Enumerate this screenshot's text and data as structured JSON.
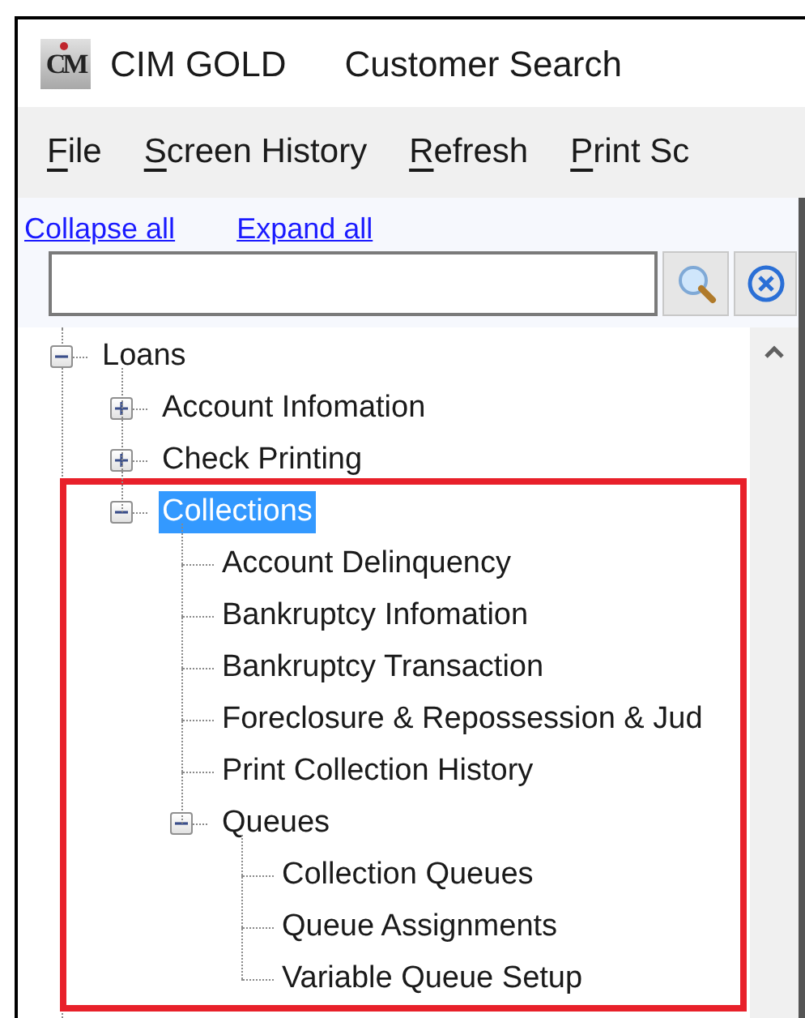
{
  "window": {
    "logo": "CM",
    "app_name": "CIM GOLD",
    "title": "Customer Search"
  },
  "menu": [
    {
      "label": "File"
    },
    {
      "label": "Screen History"
    },
    {
      "label": "Refresh"
    },
    {
      "label": "Print Sc"
    }
  ],
  "links": [
    "Collapse all",
    "Expand all"
  ],
  "tree": [
    {
      "label": "Loans",
      "kind": "group",
      "expanded": true,
      "selected": false,
      "children": [
        {
          "label": "Account Infomation",
          "kind": "group",
          "expanded": false,
          "selected": false
        },
        {
          "label": "Check Printing",
          "kind": "group",
          "expanded": false,
          "selected": false
        },
        {
          "label": "Collections",
          "kind": "group",
          "expanded": true,
          "selected": true,
          "highlighted": true,
          "children": [
            {
              "label": "Account Delinquency",
              "kind": "item",
              "selected": false
            },
            {
              "label": "Bankruptcy Infomation",
              "kind": "item",
              "selected": false
            },
            {
              "label": "Bankruptcy Transaction",
              "kind": "item",
              "selected": false
            },
            {
              "label": "Foreclosure & Repossession & Jud",
              "kind": "item",
              "selected": false
            },
            {
              "label": "Print Collection History",
              "kind": "item",
              "selected": false
            },
            {
              "label": "Queues",
              "kind": "group",
              "expanded": true,
              "selected": false,
              "children": [
                {
                  "label": "Collection Queues",
                  "kind": "item",
                  "selected": false
                },
                {
                  "label": "Queue Assignments",
                  "kind": "item",
                  "selected": false
                },
                {
                  "label": "Variable Queue Setup",
                  "kind": "item",
                  "selected": false
                }
              ]
            }
          ]
        }
      ]
    }
  ]
}
